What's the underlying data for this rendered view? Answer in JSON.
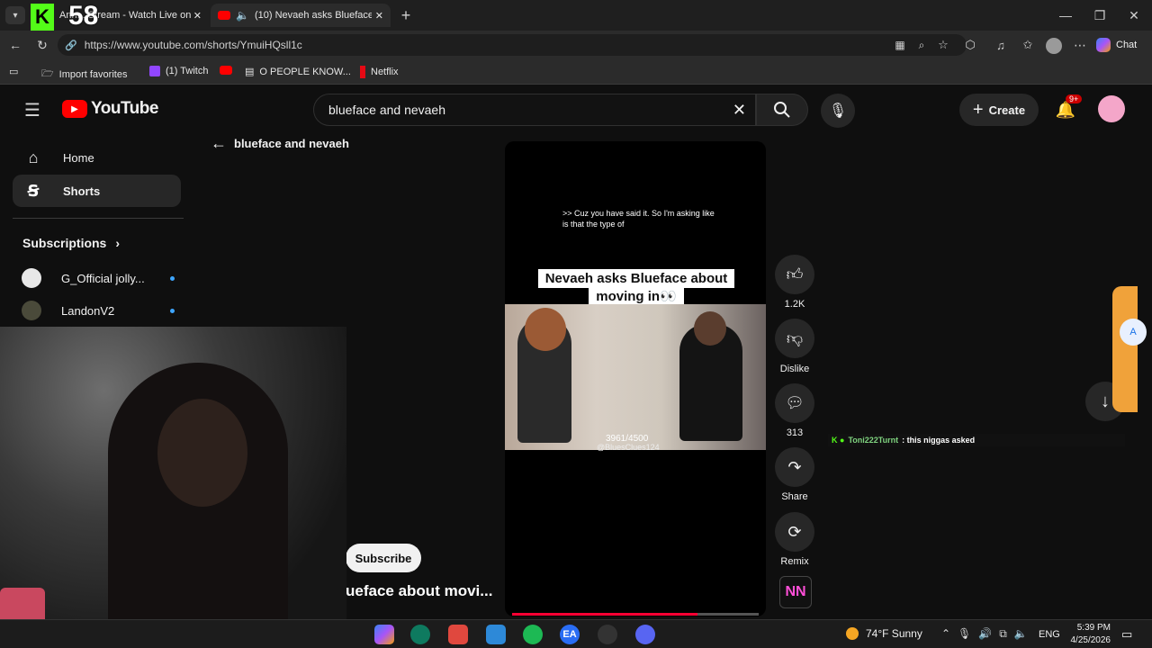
{
  "browser": {
    "tabs": [
      {
        "label": "Ann... Stream - Watch Live on"
      },
      {
        "label": "(10) Nevaeh asks Blueface abo"
      }
    ],
    "overlay_number": "58",
    "url": "https://www.youtube.com/shorts/YmuiHQsll1c",
    "chat_label": "Chat",
    "bookmarks": [
      {
        "label": "Import favorites"
      },
      {
        "label": "(1) Twitch"
      },
      {
        "label": ""
      },
      {
        "label": "O PEOPLE KNOW..."
      },
      {
        "label": "Netflix"
      }
    ]
  },
  "youtube": {
    "logo_text": "YouTube",
    "search_value": "blueface and nevaeh",
    "create_label": "Create",
    "notif_badge": "9+",
    "back_query": "blueface and nevaeh",
    "sidebar": {
      "items": [
        {
          "label": "Home"
        },
        {
          "label": "Shorts"
        }
      ],
      "subscriptions_title": "Subscriptions",
      "subscriptions": [
        {
          "label": "G_Official jolly..."
        },
        {
          "label": "LandonV2"
        }
      ]
    },
    "video": {
      "caption_line1": ">> Cuz you have said it. So I'm asking like",
      "caption_line2": "is that the type of",
      "title_line1": "Nevaeh asks Blueface about",
      "title_line2": "moving in👀",
      "counter": "3961/4500",
      "watermark": "@BluesClues124",
      "progress": 0.75
    },
    "actions": {
      "likes": "1.2K",
      "dislike": "Dislike",
      "comments": "313",
      "share": "Share",
      "remix": "Remix"
    },
    "subscribe_label": "Subscribe",
    "title_overlay": "ueface about movi...",
    "chat_msg": {
      "user": "Toni222Turnt",
      "text": ": this niggas asked"
    }
  },
  "taskbar": {
    "weather": "74°F  Sunny",
    "lang": "ENG",
    "time": "5:39 PM",
    "date": "4/25/2026"
  },
  "colors": {
    "yt_red": "#ff0000",
    "accent_blue": "#3ea6ff",
    "bg": "#0f0f0f"
  }
}
